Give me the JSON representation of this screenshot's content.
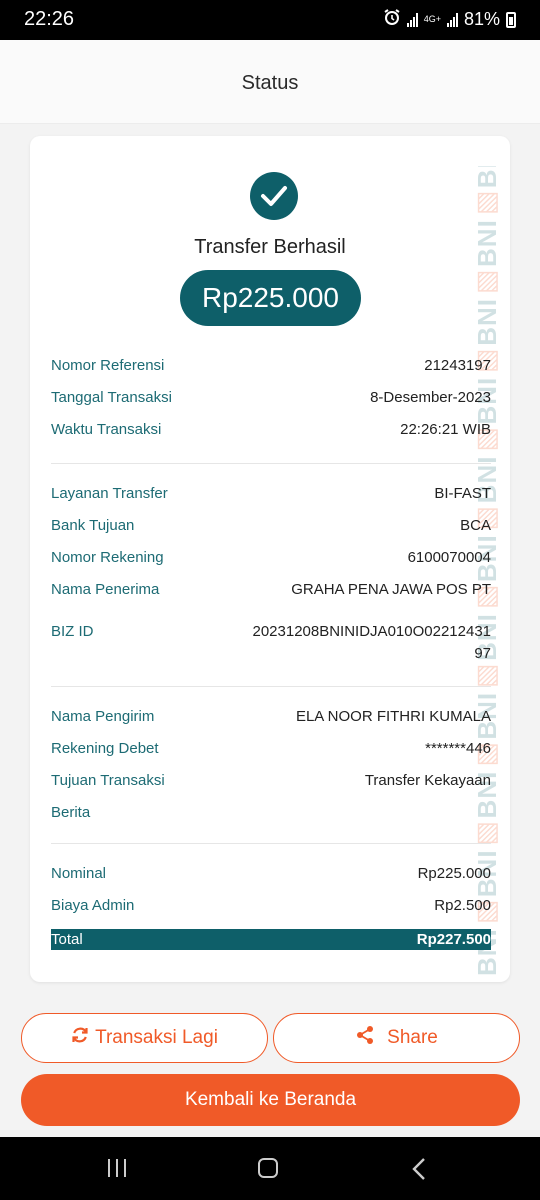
{
  "status_bar": {
    "time": "22:26",
    "network_top": "4G+",
    "battery": "81%"
  },
  "header": {
    "title": "Status"
  },
  "receipt": {
    "status_title": "Transfer Berhasil",
    "amount": "Rp225.000",
    "watermark_text": "BNI",
    "rows_section1": [
      {
        "label": "Nomor Referensi",
        "value": "21243197"
      },
      {
        "label": "Tanggal Transaksi",
        "value": "8-Desember-2023"
      },
      {
        "label": "Waktu Transaksi",
        "value": "22:26:21 WIB"
      }
    ],
    "rows_section2": [
      {
        "label": "Layanan Transfer",
        "value": "BI-FAST"
      },
      {
        "label": "Bank Tujuan",
        "value": "BCA"
      },
      {
        "label": "Nomor Rekening",
        "value": "6100070004"
      },
      {
        "label": "Nama Penerima",
        "value": "GRAHA PENA JAWA POS PT"
      },
      {
        "label": "BIZ ID",
        "value": "20231208BNINIDJA010O0221243197"
      }
    ],
    "rows_section3": [
      {
        "label": "Nama Pengirim",
        "value": "ELA NOOR FITHRI KUMALA"
      },
      {
        "label": "Rekening Debet",
        "value": "*******446"
      },
      {
        "label": "Tujuan Transaksi",
        "value": "Transfer Kekayaan"
      },
      {
        "label": "Berita",
        "value": ""
      }
    ],
    "rows_section4": [
      {
        "label": "Nominal",
        "value": "Rp225.000"
      },
      {
        "label": "Biaya Admin",
        "value": "Rp2.500"
      }
    ],
    "total": {
      "label": "Total",
      "value": "Rp227.500"
    }
  },
  "actions": {
    "repeat_label": "Transaksi Lagi",
    "share_label": "Share",
    "home_label": "Kembali ke Beranda"
  },
  "colors": {
    "primary_teal": "#0e5f69",
    "accent_orange": "#f05a28"
  }
}
